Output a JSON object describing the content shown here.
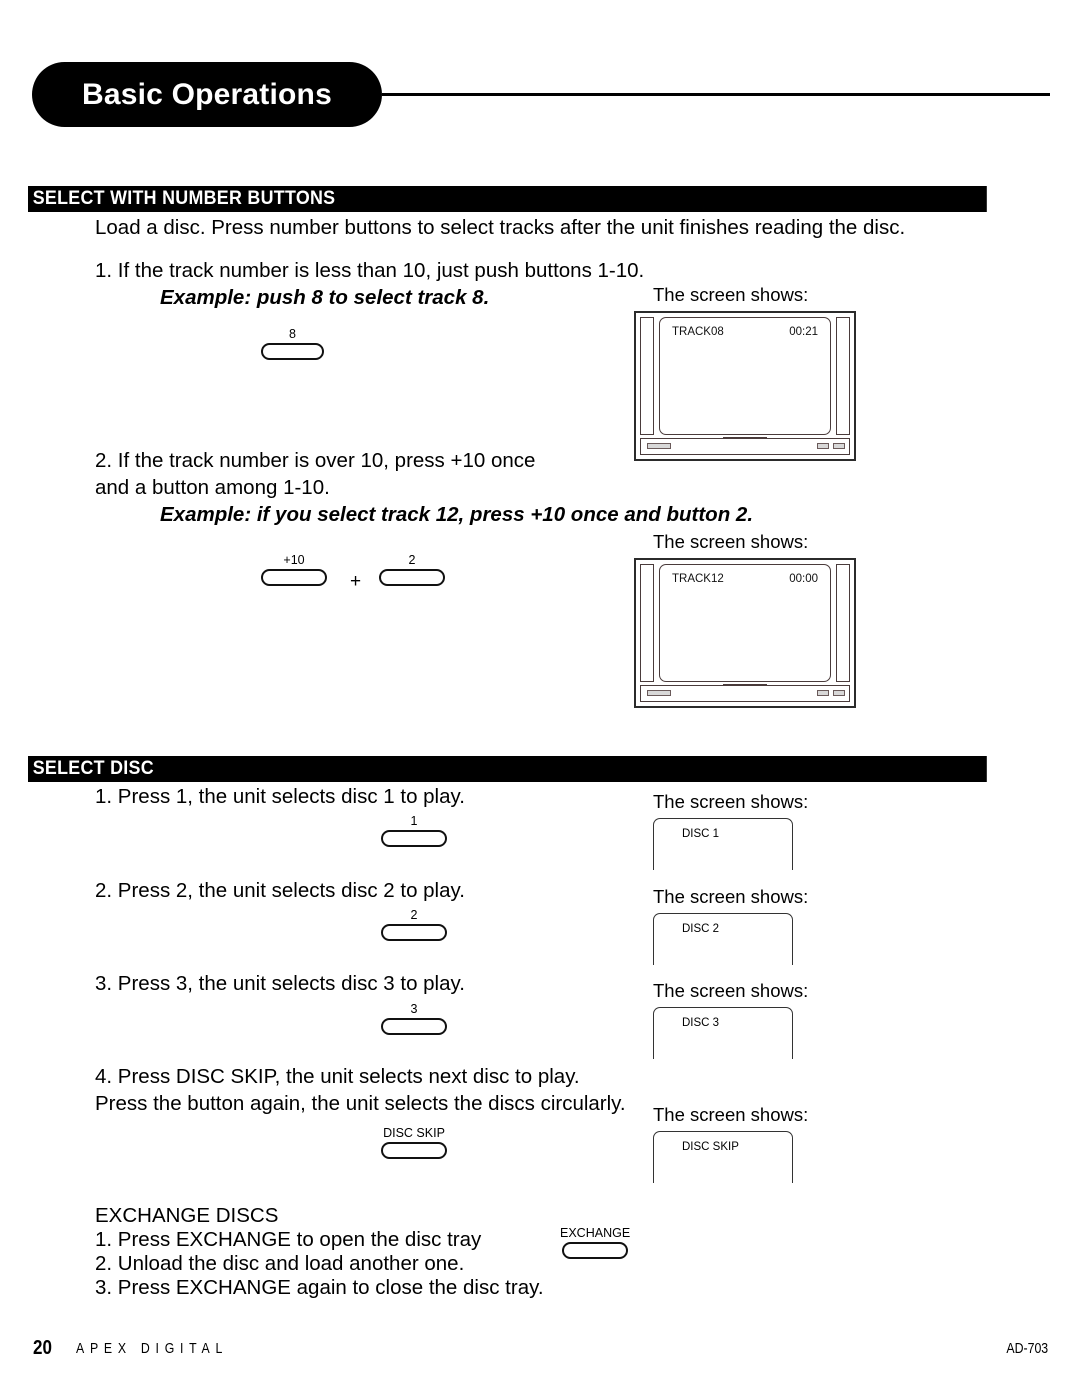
{
  "page": {
    "chapter_title": "Basic Operations"
  },
  "sections": {
    "number_buttons": {
      "heading": "SELECT WITH NUMBER BUTTONS",
      "intro": "Load a disc.  Press number buttons to select tracks after the unit finishes reading the disc.",
      "step1_line1": "1. If the track number is less than 10, just push buttons 1-10.",
      "step1_example": "Example:  push 8 to select track 8.",
      "step1_button_label": "8",
      "step1_screen_caption": "The screen shows:",
      "step1_screen_track": "TRACK08",
      "step1_screen_time": "00:21",
      "step2_line1": "2. If the track number is over 10, press +10 once",
      "step2_line2": "and a button among 1-10.",
      "step2_example": "Example:  if you select track 12, press +10 once and button 2.",
      "step2_button_a_label": "+10",
      "step2_plus": "+",
      "step2_button_b_label": "2",
      "step2_screen_caption": "The screen shows:",
      "step2_screen_track": "TRACK12",
      "step2_screen_time": "00:00"
    },
    "select_disc": {
      "heading": "SELECT DISC",
      "step1_text": "1. Press 1, the unit selects disc 1 to play.",
      "step1_button_label": "1",
      "step1_screen_caption": "The screen shows:",
      "step1_screen_text": "DISC 1",
      "step2_text": "2. Press 2, the unit selects disc 2 to play.",
      "step2_button_label": "2",
      "step2_screen_caption": "The screen shows:",
      "step2_screen_text": "DISC 2",
      "step3_text": "3. Press 3, the unit selects disc 3 to play.",
      "step3_button_label": "3",
      "step3_screen_caption": "The screen shows:",
      "step3_screen_text": "DISC 3",
      "step4_line1": "4. Press DISC SKIP, the unit selects next disc to play.",
      "step4_line2": "Press the button again, the unit selects the discs circularly.",
      "step4_button_label": "DISC SKIP",
      "step4_screen_caption": "The screen shows:",
      "step4_screen_text": "DISC SKIP"
    },
    "exchange_discs": {
      "heading": "EXCHANGE DISCS",
      "line1": "1. Press EXCHANGE to open the disc tray",
      "line2": "2. Unload the disc and load another one.",
      "line3": "3. Press EXCHANGE again to close the disc tray.",
      "button_label": "EXCHANGE"
    }
  },
  "footer": {
    "page_number": "20",
    "brand": "APEX DIGITAL",
    "model": "AD-703"
  }
}
